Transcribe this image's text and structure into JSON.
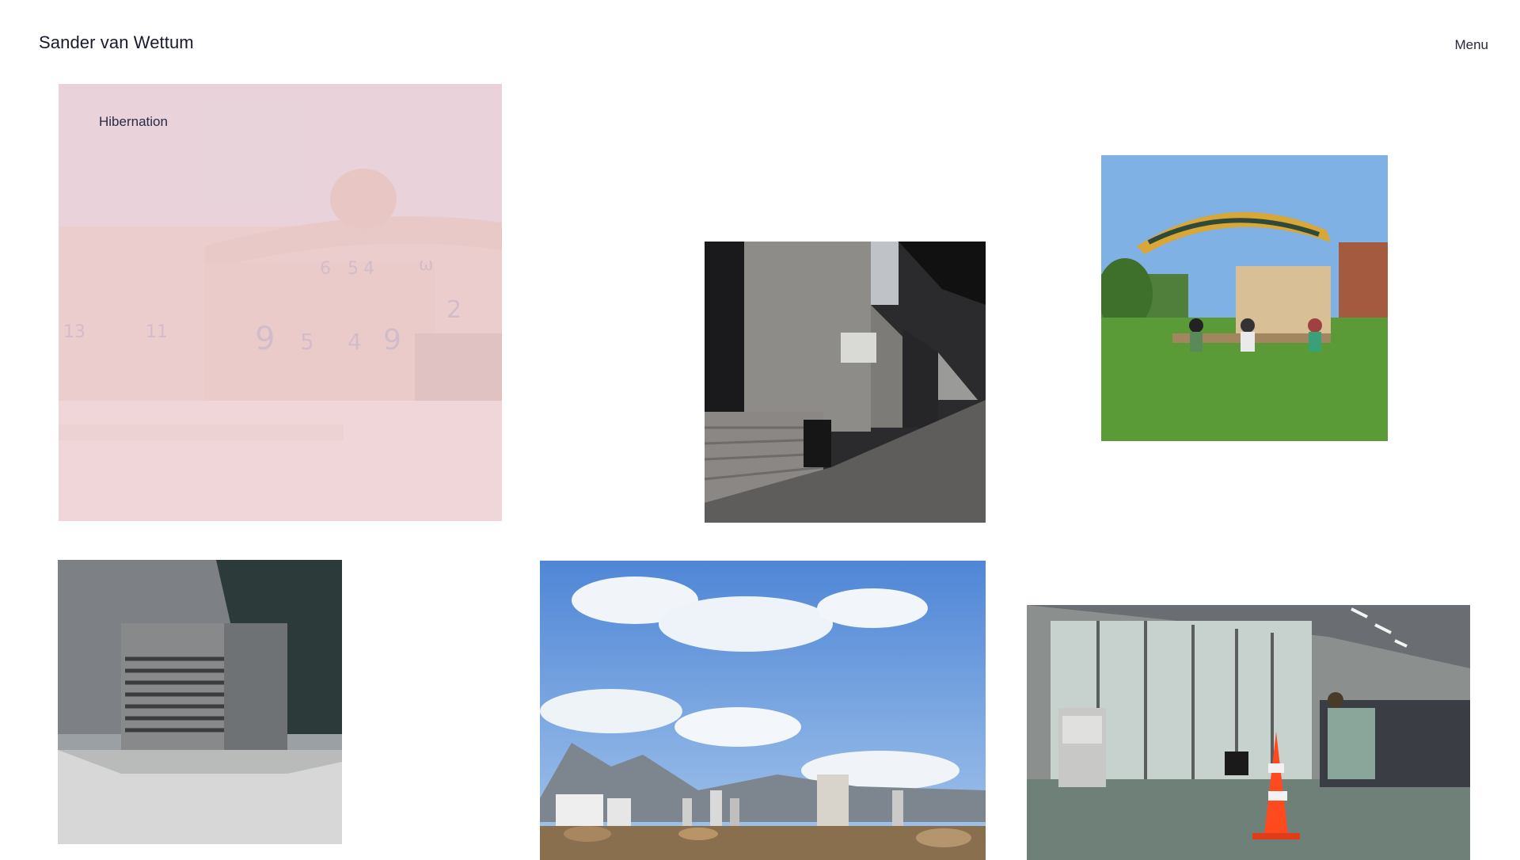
{
  "header": {
    "site_title": "Sander van Wettum",
    "menu_label": "Menu"
  },
  "gallery": {
    "tiles": [
      {
        "caption": "Hibernation",
        "subject": "concrete structure with dome and painted numbers",
        "hovered": true
      },
      {
        "caption": "",
        "subject": "concrete stairs under overpass"
      },
      {
        "caption": "",
        "subject": "people sitting under striped canopy on grass"
      },
      {
        "caption": "",
        "subject": "grey building facade with louvered box"
      },
      {
        "caption": "",
        "subject": "city skyline with mountains and clouds"
      },
      {
        "caption": "",
        "subject": "office interior with printers and traffic cone"
      }
    ],
    "painted_numbers": [
      "6",
      "5",
      "4",
      "ω",
      "11",
      "9",
      "5",
      "4",
      "9",
      "2",
      "13"
    ]
  },
  "colors": {
    "background": "#ffffff",
    "text": "#1c1c2e",
    "hover_overlay": "#f4d6dc"
  }
}
